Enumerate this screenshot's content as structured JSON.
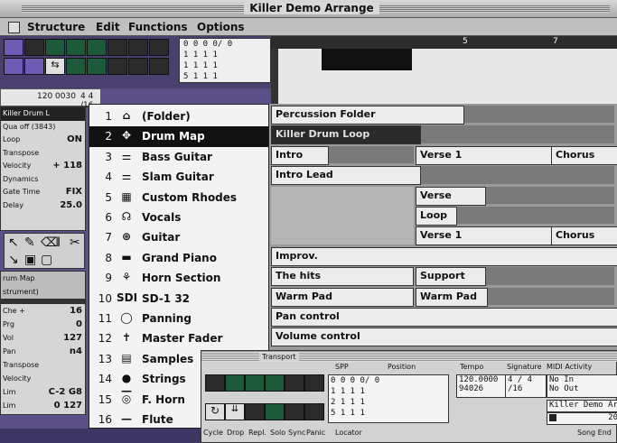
{
  "window": {
    "title": "Killer Demo Arrange"
  },
  "menubar": {
    "items": [
      "Structure",
      "Edit",
      "Functions",
      "Options"
    ]
  },
  "toolbar": {
    "position_rows": [
      "0  0  0  0/ 0",
      "1  1  1  1",
      "1  1  1  1",
      "5  1  1  1"
    ],
    "tempo_readout": "120 0030",
    "signature": "4  4  /16"
  },
  "ruler": {
    "bars": [
      "5",
      "7"
    ]
  },
  "inspector": {
    "track_name": "Killer Drum L",
    "rows": [
      {
        "label": "Qua off (3843)",
        "value": ""
      },
      {
        "label": "Loop",
        "value": "ON"
      },
      {
        "label": "Transpose",
        "value": ""
      },
      {
        "label": "Velocity",
        "value": "+ 118"
      },
      {
        "label": "Dynamics",
        "value": ""
      },
      {
        "label": "Gate Time",
        "value": "FIX"
      },
      {
        "label": "Delay",
        "value": "25.0"
      }
    ]
  },
  "inspector2": {
    "header": [
      "rum Map",
      "strument)"
    ],
    "rows": [
      {
        "label": "Che  +",
        "value": "16"
      },
      {
        "label": "Prg",
        "value": "0"
      },
      {
        "label": "Vol",
        "value": "127"
      },
      {
        "label": "Pan",
        "value": "n4"
      },
      {
        "label": "Transpose",
        "value": ""
      },
      {
        "label": "Velocity",
        "value": ""
      },
      {
        "label": "Lim",
        "value": "C-2  G8"
      },
      {
        "label": "Lim",
        "value": "0  127"
      }
    ]
  },
  "tracks": [
    {
      "num": "1",
      "icon": "folder-icon",
      "glyph": "⌂",
      "name": "(Folder)"
    },
    {
      "num": "2",
      "icon": "drum-map-icon",
      "glyph": "✥",
      "name": "Drum Map",
      "selected": true
    },
    {
      "num": "3",
      "icon": "bass-guitar-icon",
      "glyph": "⚌",
      "name": "Bass Guitar"
    },
    {
      "num": "4",
      "icon": "slam-guitar-icon",
      "glyph": "⚌",
      "name": "Slam Guitar"
    },
    {
      "num": "5",
      "icon": "keyboard-icon",
      "glyph": "▦",
      "name": "Custom Rhodes"
    },
    {
      "num": "6",
      "icon": "vocals-icon",
      "glyph": "☊",
      "name": "Vocals"
    },
    {
      "num": "7",
      "icon": "guitar-icon",
      "glyph": "⊛",
      "name": "Guitar"
    },
    {
      "num": "8",
      "icon": "piano-icon",
      "glyph": "▬",
      "name": "Grand Piano"
    },
    {
      "num": "9",
      "icon": "horn-section-icon",
      "glyph": "⚘",
      "name": "Horn Section"
    },
    {
      "num": "10",
      "icon": "sd1-icon",
      "glyph": "SDI",
      "name": "SD-1 32"
    },
    {
      "num": "11",
      "icon": "panning-icon",
      "glyph": "◯",
      "name": "Panning"
    },
    {
      "num": "12",
      "icon": "master-fader-icon",
      "glyph": "✝",
      "name": "Master Fader"
    },
    {
      "num": "13",
      "icon": "samples-icon",
      "glyph": "▤",
      "name": "Samples"
    },
    {
      "num": "14",
      "icon": "strings-icon",
      "glyph": "●—",
      "name": "Strings"
    },
    {
      "num": "15",
      "icon": "french-horn-icon",
      "glyph": "◎",
      "name": "F. Horn"
    },
    {
      "num": "16",
      "icon": "flute-icon",
      "glyph": "—",
      "name": "Flute"
    }
  ],
  "arrange": {
    "parts": [
      {
        "name": "Percussion Folder",
        "row": 0,
        "style": "light"
      },
      {
        "name": "Killer Drum Loop",
        "row": 1,
        "style": "dark"
      },
      {
        "name": "Intro",
        "row": 2,
        "style": "light"
      },
      {
        "name": "Verse 1",
        "row": 2,
        "style": "light"
      },
      {
        "name": "Chorus",
        "row": 2,
        "style": "light"
      },
      {
        "name": "Intro Lead",
        "row": 3,
        "style": "light"
      },
      {
        "name": "Verse",
        "row": 4,
        "style": "light"
      },
      {
        "name": "Loop",
        "row": 5,
        "style": "light"
      },
      {
        "name": "Verse 1",
        "row": 6,
        "style": "light"
      },
      {
        "name": "Chorus",
        "row": 6,
        "style": "light"
      },
      {
        "name": "Improv.",
        "row": 7,
        "style": "light"
      },
      {
        "name": "The hits",
        "row": 8,
        "style": "light"
      },
      {
        "name": "Support",
        "row": 8,
        "style": "light"
      },
      {
        "name": "Warm Pad",
        "row": 9,
        "style": "light"
      },
      {
        "name": "Warm Pad",
        "row": 9,
        "style": "light"
      },
      {
        "name": "Pan control",
        "row": 10,
        "style": "light"
      },
      {
        "name": "Volume control",
        "row": 11,
        "style": "light"
      }
    ]
  },
  "transport": {
    "title": "Transport",
    "labels": {
      "spp": "SPP",
      "position": "Position",
      "tempo": "Tempo",
      "signature": "Signature",
      "midi": "MIDI Activity"
    },
    "spp_rows": [
      "0  0  0  0/ 0",
      "1  1  1  1",
      "2  1  1  1",
      "5  1  1  1"
    ],
    "tempo": "120.0000",
    "tempo2": "94026",
    "sig": "4 / 4",
    "sig2": "/16",
    "midi_in": "No In",
    "midi_out": "No Out",
    "song_name": "Killer Demo Ar",
    "counter": "20",
    "bottom": [
      "Cycle",
      "Drop",
      "Repl.",
      "Solo",
      "Sync",
      "Panic",
      "Locator",
      "Song End"
    ]
  },
  "colors": {
    "bg": "#5a4f86",
    "selected": "#111111",
    "part_dark": "#2a2a2a"
  }
}
